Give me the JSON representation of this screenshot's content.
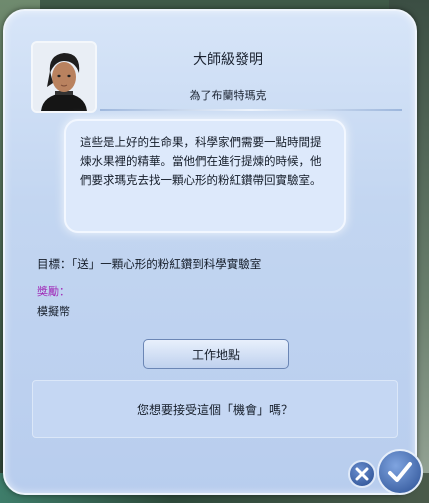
{
  "dialog": {
    "title": "大師級發明",
    "subtitle": "為了布蘭特瑪克",
    "description": "這些是上好的生命果，科學家們需要一點時間提煉水果裡的精華。當他們在進行提煉的時候，他們要求瑪克去找一顆心形的粉紅鑽帶回實驗室。",
    "goal": "目標：「送」一顆心形的粉紅鑽到科學實驗室",
    "reward_label": "獎勵：",
    "reward_value": "模擬幣",
    "map_button": "工作地點",
    "question": "您想要接受這個「機會」嗎？"
  },
  "icons": {
    "portrait": "sim-portrait",
    "cancel": "close-icon",
    "accept": "checkmark-icon"
  },
  "colors": {
    "panel": "#c3d6f1",
    "reward_label": "#a12cb8",
    "button_blue": "#2a4f93"
  }
}
